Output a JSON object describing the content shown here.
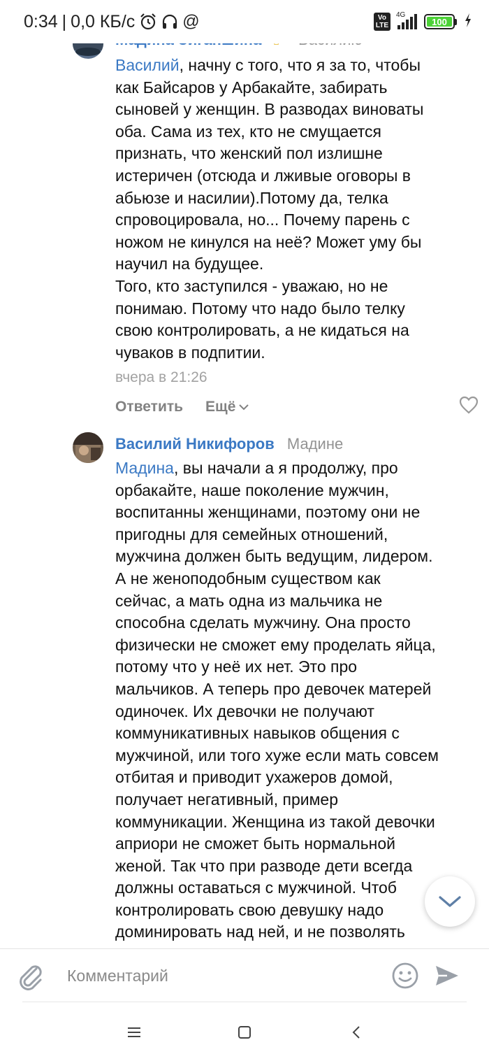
{
  "status_bar": {
    "time": "0:34",
    "separator": "|",
    "speed": "0,0 КБ/с",
    "network": "4G",
    "volte": "VoLTE",
    "battery_level": 100,
    "battery_label": "100"
  },
  "comments": [
    {
      "author": "Мадина Зиганшина",
      "author_emoji": "✌",
      "reply_to": "Василию",
      "mention": "Василий",
      "text_lines": [
        ", начну с того, что я за то, чтобы",
        "как Байсаров у Арбакайте, забирать",
        "сыновей у женщин. В разводах виноваты",
        "оба. Сама из тех, кто не смущается",
        "признать, что женский пол излишне",
        "истеричен (отсюда и лживые оговоры в",
        "абьюзе и насилии).Потому да, телка",
        "спровоцировала, но... Почему парень с",
        "ножом не кинулся на неё? Может уму бы",
        "научил на будущее.",
        "Того, кто заступился - уважаю, но не",
        "понимаю. Потому что надо было телку",
        "свою контролировать, а не кидаться на",
        "чуваков в подпитии."
      ],
      "time": "вчера в 21:26",
      "reply_label": "Ответить",
      "more_label": "Ещё"
    },
    {
      "author": "Василий Никифоров",
      "reply_to": "Мадине",
      "mention": "Мадина",
      "text_lines": [
        ", вы начали а я продолжу, про",
        "орбакайте, наше поколение мужчин,",
        "воспитанны женщинами, поэтому они не",
        "пригодны для семейных отношений,",
        "мужчина должен быть ведущим, лидером.",
        "А не женоподобным существом как",
        "сейчас, а мать одна из мальчика не",
        "способна сделать мужчину. Она просто",
        "физически не сможет ему проделать яйца,",
        "потому что у неё их нет. Это про",
        "мальчиков. А теперь про девочек матерей",
        "одиночек. Их девочки не получают",
        "коммуникативных навыков общения с",
        "мужчиной, или того хуже если мать совсем",
        "отбитая и приводит ухажеров домой,",
        "получает негативный, пример",
        "коммуникации. Женщина из такой девочки",
        "априори не сможет быть нормальной",
        "женой. Так что при разводе дети всегда",
        "должны оставаться с мужчиной. Чтоб",
        "контролировать свою девушку надо",
        "доминировать над ней, и не позволять"
      ]
    }
  ],
  "composer": {
    "placeholder": "Комментарий"
  },
  "icons": {
    "alarm": "alarm-icon",
    "headphones": "headphones-icon",
    "at": "at-icon",
    "signal": "signal-icon",
    "charging": "charging-icon",
    "attach": "paperclip-icon",
    "emoji": "smiley-icon",
    "send": "send-icon",
    "like": "heart-icon",
    "scroll_down": "chevron-down-icon",
    "menu": "menu-icon",
    "home": "square-icon",
    "back": "back-icon"
  },
  "colors": {
    "link": "#3b79c4",
    "muted": "#939393",
    "battery": "#4cd137"
  }
}
